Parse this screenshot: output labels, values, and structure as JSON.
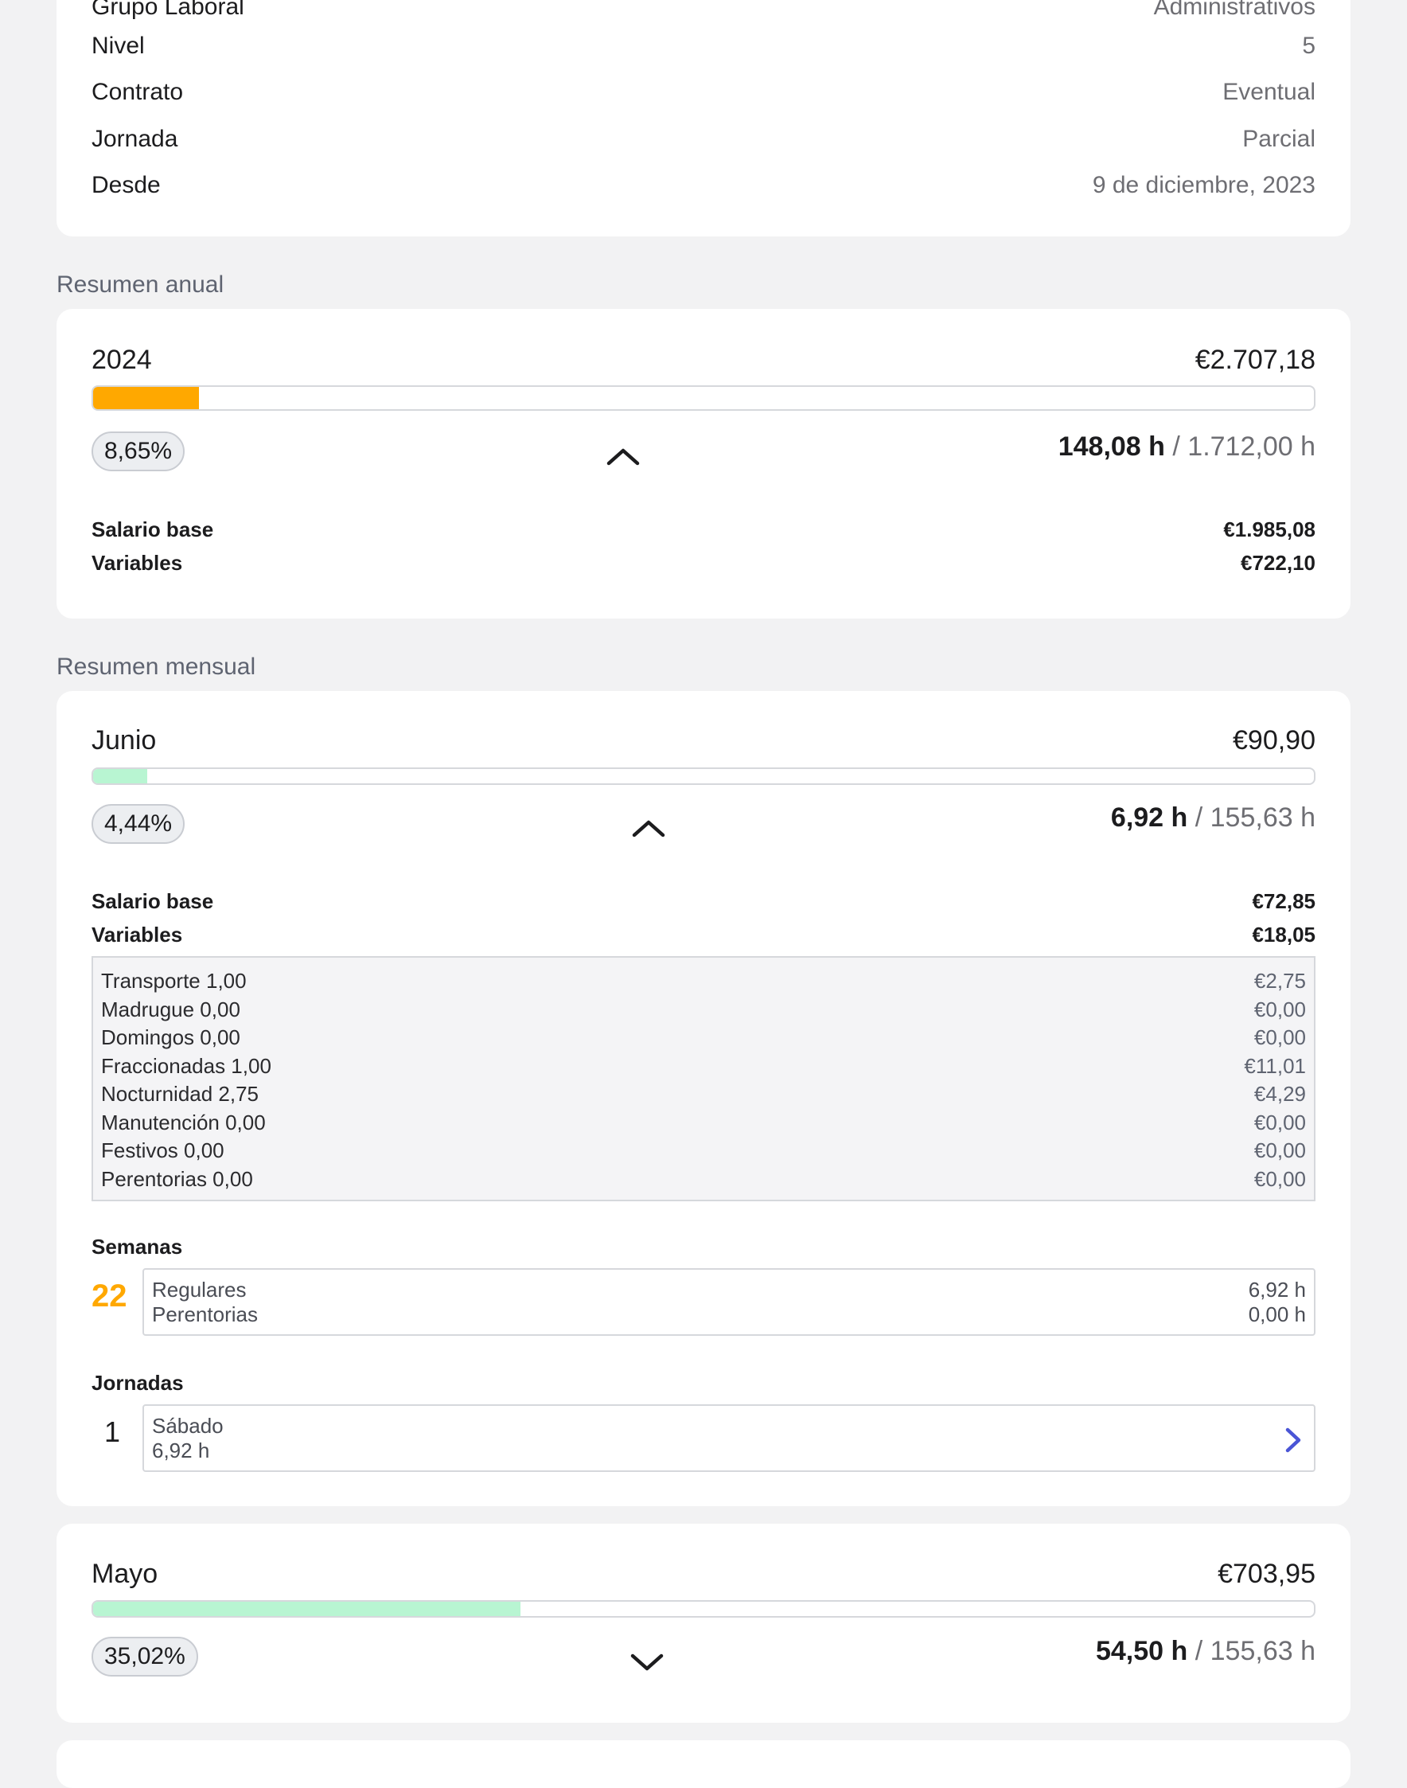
{
  "employee_info": {
    "rows": [
      {
        "label": "Grupo Laboral",
        "value": "Administrativos"
      },
      {
        "label": "Nivel",
        "value": "5"
      },
      {
        "label": "Contrato",
        "value": "Eventual"
      },
      {
        "label": "Jornada",
        "value": "Parcial"
      },
      {
        "label": "Desde",
        "value": "9 de diciembre, 2023"
      }
    ]
  },
  "annual": {
    "section_label": "Resumen anual",
    "year": "2024",
    "total": "€2.707,18",
    "progress_percent": 8.65,
    "progress_color": "#ffa800",
    "percent_label": "8,65%",
    "hours_worked": "148,08 h",
    "hours_total": "/ 1.712,00 h",
    "salario_base_label": "Salario base",
    "salario_base": "€1.985,08",
    "variables_label": "Variables",
    "variables": "€722,10"
  },
  "monthly": {
    "section_label": "Resumen mensual",
    "junio": {
      "month": "Junio",
      "total": "€90,90",
      "progress_percent": 4.44,
      "progress_color": "#b8f5d2",
      "percent_label": "4,44%",
      "hours_worked": "6,92 h",
      "hours_total": "/ 155,63 h",
      "salario_base_label": "Salario base",
      "salario_base": "€72,85",
      "variables_label": "Variables",
      "variables": "€18,05",
      "variables_items": [
        {
          "label": "Transporte 1,00",
          "amount": "€2,75"
        },
        {
          "label": "Madrugue 0,00",
          "amount": "€0,00"
        },
        {
          "label": "Domingos 0,00",
          "amount": "€0,00"
        },
        {
          "label": "Fraccionadas 1,00",
          "amount": "€11,01"
        },
        {
          "label": "Nocturnidad 2,75",
          "amount": "€4,29"
        },
        {
          "label": "Manutención 0,00",
          "amount": "€0,00"
        },
        {
          "label": "Festivos 0,00",
          "amount": "€0,00"
        },
        {
          "label": "Perentorias 0,00",
          "amount": "€0,00"
        }
      ],
      "semanas_label": "Semanas",
      "semana_number": "22",
      "semana_number_color": "#ffa800",
      "semana_regulares_label": "Regulares",
      "semana_regulares_value": "6,92 h",
      "semana_perentorias_label": "Perentorias",
      "semana_perentorias_value": "0,00 h",
      "jornadas_label": "Jornadas",
      "jornada_number": "1",
      "jornada_day": "Sábado",
      "jornada_hours": "6,92 h"
    },
    "mayo": {
      "month": "Mayo",
      "total": "€703,95",
      "progress_percent": 35.02,
      "progress_color": "#b8f5d2",
      "percent_label": "35,02%",
      "hours_worked": "54,50 h",
      "hours_total": "/ 155,63 h"
    }
  },
  "icons": {
    "collapse": "chevron-up-icon",
    "expand": "chevron-down-icon",
    "detail": "chevron-right-icon",
    "accent_color": "#4a55d6"
  }
}
